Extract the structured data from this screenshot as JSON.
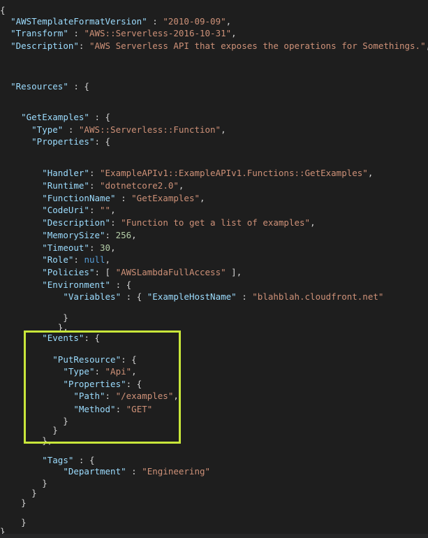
{
  "code": {
    "open_root": "{",
    "k_awsformat": "\"AWSTemplateFormatVersion\"",
    "v_awsformat": "\"2010-09-09\"",
    "k_transform": "\"Transform\"",
    "v_transform": "\"AWS::Serverless-2016-10-31\"",
    "k_description": "\"Description\"",
    "v_description": "\"AWS Serverless API that exposes the operations for Somethings.\"",
    "k_resources": "\"Resources\"",
    "k_getexamples": "\"GetExamples\"",
    "k_type": "\"Type\"",
    "v_type_fn": "\"AWS::Serverless::Function\"",
    "k_properties": "\"Properties\"",
    "k_handler": "\"Handler\"",
    "v_handler": "\"ExampleAPIv1::ExampleAPIv1.Functions::GetExamples\"",
    "k_runtime": "\"Runtime\"",
    "v_runtime": "\"dotnetcore2.0\"",
    "k_functionname": "\"FunctionName\"",
    "v_functionname": "\"GetExamples\"",
    "k_codeuri": "\"CodeUri\"",
    "v_codeuri": "\"\"",
    "k_fn_description": "\"Description\"",
    "v_fn_description": "\"Function to get a list of examples\"",
    "k_memorysize": "\"MemorySize\"",
    "v_memorysize": "256",
    "k_timeout": "\"Timeout\"",
    "v_timeout": "30",
    "k_role": "\"Role\"",
    "v_role": "null",
    "k_policies": "\"Policies\"",
    "v_policies": "\"AWSLambdaFullAccess\"",
    "k_environment": "\"Environment\"",
    "k_variables": "\"Variables\"",
    "k_hostname": "\"ExampleHostName\"",
    "v_hostname": "\"blahblah.cloudfront.net\"",
    "k_events": "\"Events\"",
    "k_putresource": "\"PutResource\"",
    "k_ev_type": "\"Type\"",
    "v_ev_type": "\"Api\"",
    "k_ev_properties": "\"Properties\"",
    "k_path": "\"Path\"",
    "v_path": "\"/examples\"",
    "k_method": "\"Method\"",
    "v_method": "\"GET\"",
    "k_tags": "\"Tags\"",
    "k_department": "\"Department\"",
    "v_department": "\"Engineering\""
  },
  "colors": {
    "background": "#1e1e1e",
    "key": "#9cdcfe",
    "string": "#ce9178",
    "number": "#b5cea8",
    "keyword": "#569cd6",
    "highlight": "#c8e63a"
  }
}
